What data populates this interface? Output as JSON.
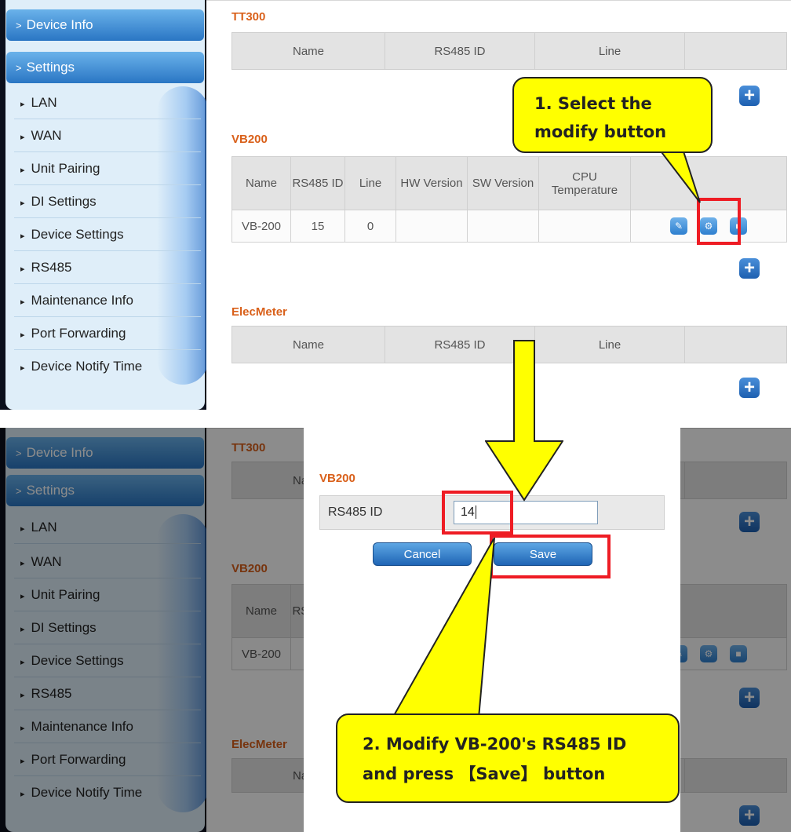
{
  "sidebar": {
    "main": [
      "Device Info",
      "Settings"
    ],
    "items": [
      "LAN",
      "WAN",
      "Unit Pairing",
      "DI Settings",
      "Device Settings",
      "RS485",
      "Maintenance Info",
      "Port Forwarding",
      "Device Notify Time"
    ]
  },
  "tt300": {
    "title": "TT300",
    "headers": [
      "Name",
      "RS485 ID",
      "Line"
    ]
  },
  "vb200": {
    "title": "VB200",
    "headers": [
      "Name",
      "RS485 ID",
      "Line",
      "HW Version",
      "SW Version",
      "CPU Temperature"
    ],
    "row": [
      "VB-200",
      "15",
      "0"
    ]
  },
  "elecmeter": {
    "title": "ElecMeter",
    "headers": [
      "Name",
      "RS485 ID",
      "Line"
    ]
  },
  "dialog": {
    "title": "VB200",
    "field_label": "RS485 ID",
    "field_value": "14",
    "cancel_label": "Cancel",
    "save_label": "Save"
  },
  "callouts": {
    "step1_line1": "1. Select the",
    "step1_line2": "modify button",
    "step2_line1": "2. Modify VB-200's RS485 ID",
    "step2_line2": "and press 【Save】 button"
  },
  "colors": {
    "title_orange": "#d9601a",
    "menu_blue": "#2a76c4",
    "highlight_red": "#ee1c24",
    "callout_yellow": "#ffff00"
  },
  "icons": {
    "expand": "chevron-right-icon",
    "add": "plus-icon",
    "edit": "pencil-icon",
    "modify": "gear-icon",
    "delete": "trash-icon"
  }
}
